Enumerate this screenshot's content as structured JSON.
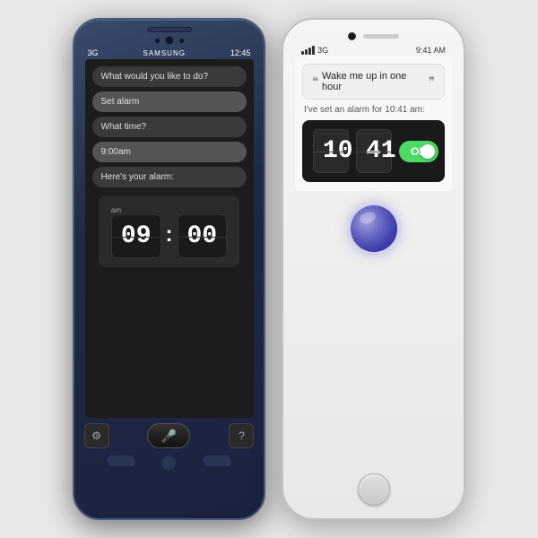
{
  "samsung": {
    "brand": "SAMSUNG",
    "time": "12:45",
    "signal": "3G",
    "screen": {
      "bubble1": "What would you like to do?",
      "bubble2": "Set alarm",
      "bubble3": "What time?",
      "bubble4": "9:00am",
      "bubble5": "Here's your alarm:",
      "alarm_hour": "09",
      "alarm_minute": "00",
      "am_label": "am"
    },
    "nav": {
      "back": "◁",
      "home": "",
      "menu": "□"
    }
  },
  "iphone": {
    "signal": "•••",
    "network": "3G",
    "time": "9:41 AM",
    "screen": {
      "siri_quote": "Wake me up in one hour",
      "response": "I've set an alarm for 10:41 am:",
      "alarm_hour": "10",
      "alarm_minute": "41",
      "on_label": "ON"
    }
  }
}
